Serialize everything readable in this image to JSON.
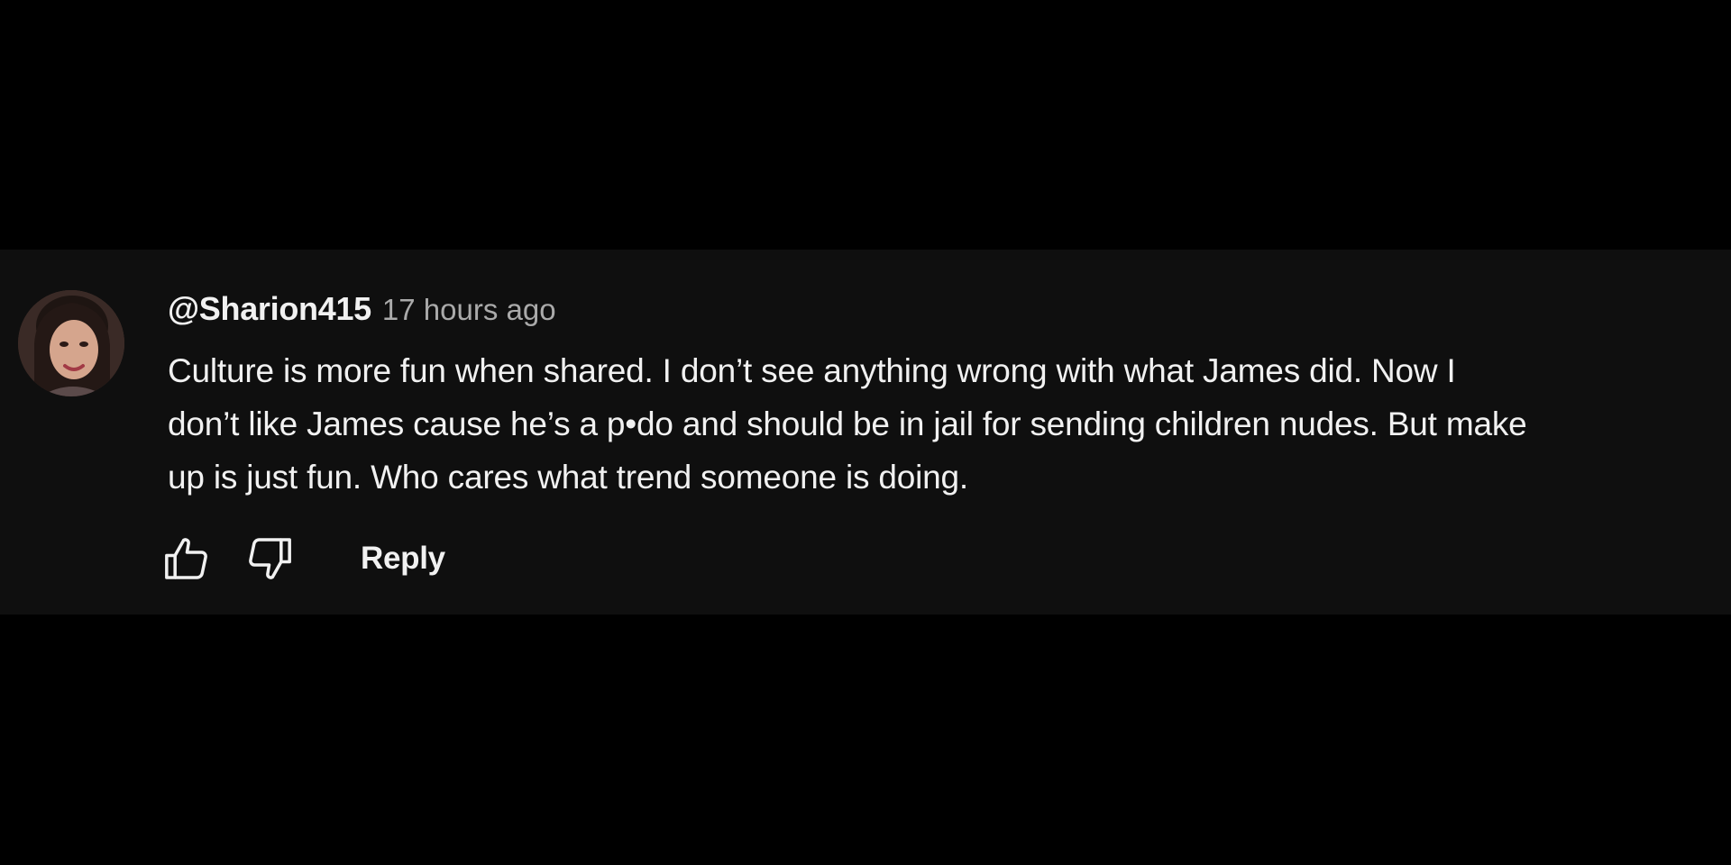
{
  "comment": {
    "author": "@Sharion415",
    "timestamp": "17 hours ago",
    "text_lines": [
      "Culture is more fun when shared. I don’t see anything wrong with what James did. Now I",
      "don’t like James cause he’s a p•do and should be in jail for sending children nudes. But make",
      "up is just fun. Who cares what trend someone is doing."
    ],
    "avatar_icon": "user-avatar-photo"
  },
  "actions": {
    "like_icon": "thumbs-up-icon",
    "dislike_icon": "thumbs-down-icon",
    "reply_label": "Reply"
  },
  "colors": {
    "page_background": "#000000",
    "panel_background": "#0f0f0f",
    "primary_text": "#f1f1f1",
    "secondary_text": "#aaaaaa"
  }
}
